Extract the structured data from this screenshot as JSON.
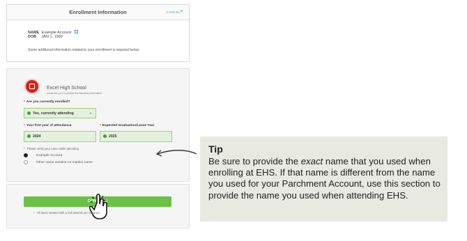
{
  "header": {
    "title": "Enrollment Information",
    "cancel_label": "CANCEL",
    "close_glyph": "✕"
  },
  "student": {
    "name_key": "NAME",
    "name_value": "Example Account",
    "dob_key": "DOB",
    "dob_value": "JAN 1, 1990",
    "note": "Some additional information related to your enrollment is required below."
  },
  "school": {
    "name": "Excel High School",
    "subtitle": "would like you to provide the following information:"
  },
  "form": {
    "q_enrolled": "Are you currently enrolled?",
    "enrolled_value": "Yes, currently attending",
    "q_first_year": "Your first year of attendance",
    "first_year_value": "2024",
    "q_grad_year": "Expected Graduation/Leave Year",
    "grad_year_value": "2025",
    "verify_note": "Please verify your name while attending",
    "option_1": "Example Account",
    "option_2": "Other name variation or maiden name"
  },
  "footer": {
    "continue_label": "CONTINUE",
    "footnote": "All items marked with a red asterisk are required."
  },
  "tip": {
    "title": "Tip",
    "body_1": "Be sure to provide the ",
    "body_em": "exact",
    "body_2": " name that you used when enrolling at EHS. If that name is different from the name you used for your Parchment Account, use this section to provide the name you used when attending EHS."
  },
  "colors": {
    "accent_green": "#6cc04a",
    "required_red": "#d23a2a",
    "link_blue": "#5a8fd0",
    "seal_red": "#c8271d"
  }
}
